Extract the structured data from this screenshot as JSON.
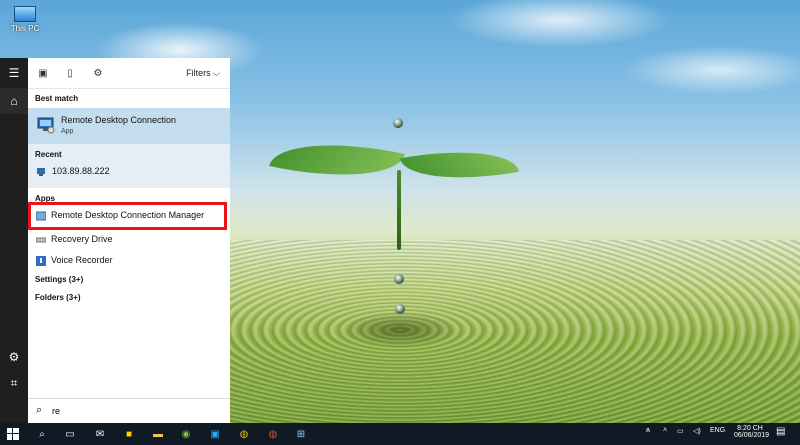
{
  "desktop": {
    "icon_label": "This PC"
  },
  "start": {
    "toolbar": {
      "filters_label": "Filters"
    },
    "best_match": {
      "heading": "Best match",
      "title": "Remote Desktop Connection",
      "subtitle": "App"
    },
    "recent": {
      "heading": "Recent",
      "items": [
        {
          "label": "103.89.88.222"
        }
      ]
    },
    "apps": {
      "heading": "Apps",
      "items": [
        {
          "label": "Remote Desktop Connection Manager"
        },
        {
          "label": "Recovery Drive"
        },
        {
          "label": "Voice Recorder"
        }
      ]
    },
    "more_settings": "Settings (3+)",
    "more_folders": "Folders (3+)",
    "search_value": "re"
  },
  "taskbar": {
    "lang": "ENG",
    "time": "8:20 CH",
    "date": "06/06/2019"
  },
  "colors": {
    "highlight_border": "#e8141c",
    "best_match_bg": "#c3dcee",
    "taskbar_bg": "#0f1a24"
  }
}
